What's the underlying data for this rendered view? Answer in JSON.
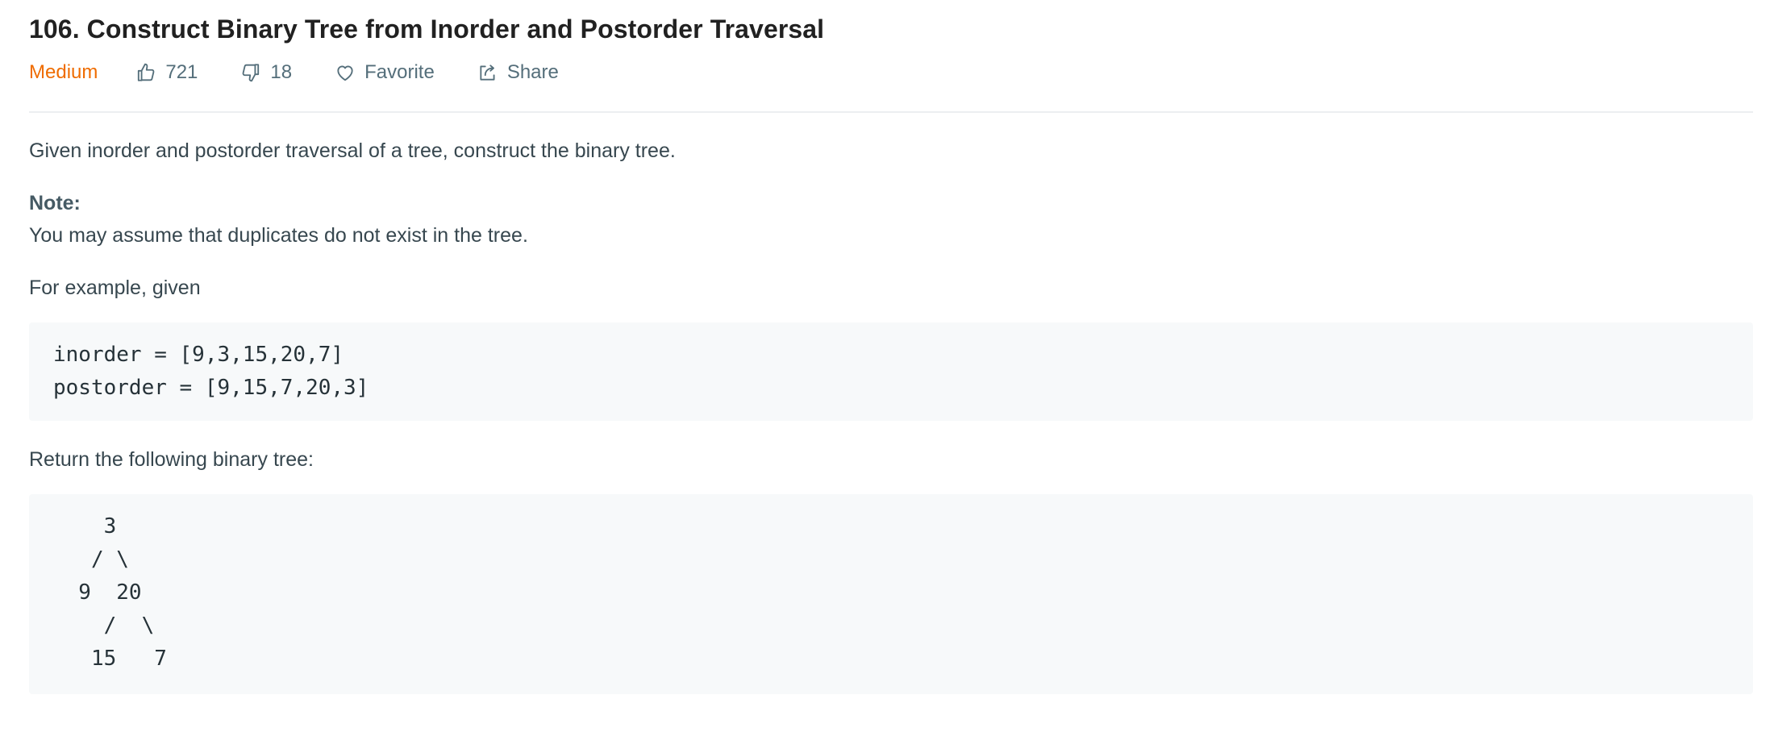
{
  "problem": {
    "title": "106. Construct Binary Tree from Inorder and Postorder Traversal",
    "difficulty": "Medium",
    "likes": "721",
    "dislikes": "18",
    "favorite_label": "Favorite",
    "share_label": "Share"
  },
  "description": {
    "intro": "Given inorder and postorder traversal of a tree, construct the binary tree.",
    "note_label": "Note:",
    "note_text": "You may assume that duplicates do not exist in the tree.",
    "example_intro": "For example, given",
    "example_code": [
      "inorder = [9,3,15,20,7]",
      "postorder = [9,15,7,20,3]"
    ],
    "return_text": "Return the following binary tree:",
    "tree_code": [
      "    3",
      "   / \\",
      "  9  20",
      "    /  \\",
      "   15   7"
    ]
  },
  "colors": {
    "difficulty_medium": "#ef6c00",
    "title": "#212121",
    "meta_text": "#546e7a",
    "code_background": "#f7f9fa"
  },
  "icons": {
    "like": "thumbs-up-icon",
    "dislike": "thumbs-down-icon",
    "favorite": "heart-icon",
    "share": "share-icon"
  }
}
